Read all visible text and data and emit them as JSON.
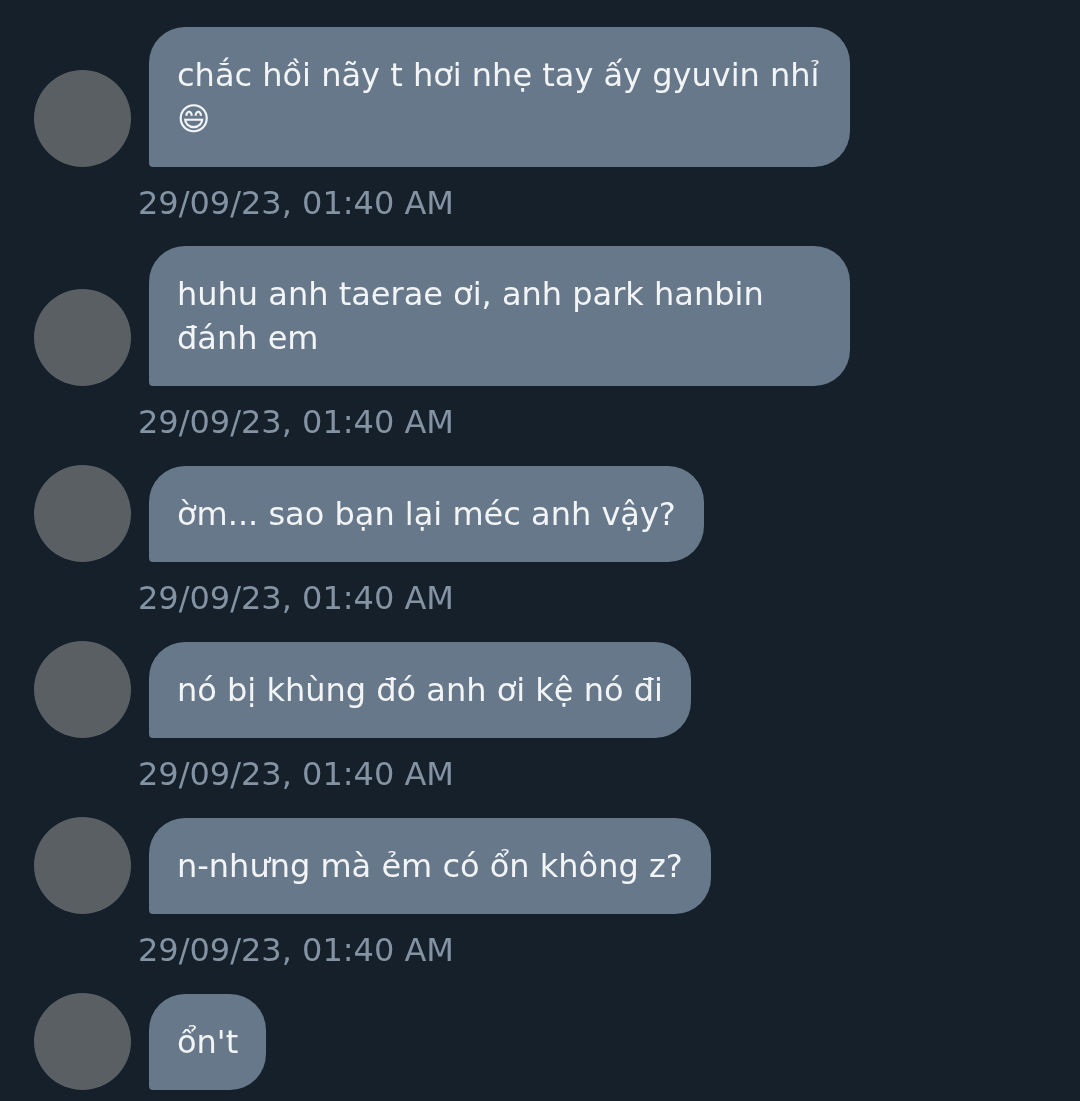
{
  "messages": [
    {
      "text": "chắc hồi nãy t hơi nhẹ tay ấy gyuvin nhỉ 😄",
      "time": "29/09/23, 01:40 AM"
    },
    {
      "text": "huhu anh taerae ơi, anh park hanbin đánh em",
      "time": "29/09/23, 01:40 AM"
    },
    {
      "text": "ờm... sao bạn lại méc anh vậy?",
      "time": "29/09/23, 01:40 AM"
    },
    {
      "text": "nó bị khùng đó anh ơi kệ nó đi",
      "time": "29/09/23, 01:40 AM"
    },
    {
      "text": "n-nhưng mà ẻm có ổn không z?",
      "time": "29/09/23, 01:40 AM"
    },
    {
      "text": "ổn't"
    }
  ]
}
